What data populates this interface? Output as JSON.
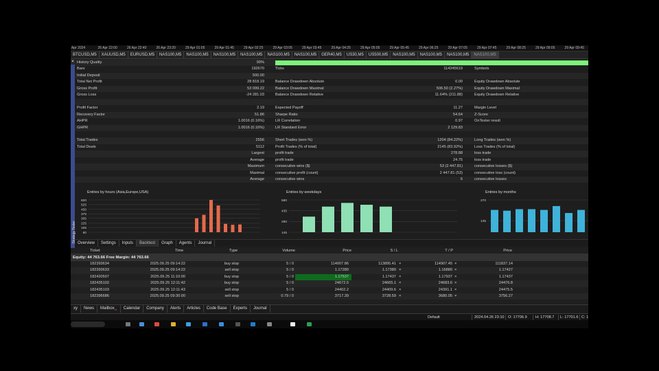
{
  "time_axis": [
    "6 Apr 2024",
    "26 Apr 22:00",
    "26 Apr 22:40",
    "26 Apr 23:20",
    "29 Apr 01:05",
    "29 Apr 01:45",
    "29 Apr 02:25",
    "29 Apr 03:05",
    "29 Apr 03:45",
    "29 Apr 04:25",
    "29 Apr 05:05",
    "29 Apr 05:45",
    "29 Apr 06:25",
    "29 Apr 07:05",
    "29 Apr 07:45",
    "29 Apr 08:25",
    "29 Apr 09:05",
    "29 Apr 09:45"
  ],
  "chart_tabs": [
    "BTCUSD,M5",
    "XAUUSD,M5",
    "EURUSD,M5",
    "NAS100,M5",
    "NAS100,M5",
    "NAS100,M5",
    "NAS100,M5",
    "NAS100,M5",
    "NAS100,M5",
    "GER40,M5",
    "US30,M5",
    "US500,M5",
    "NAS100,M5",
    "NAS100,M5",
    "NAS100,M5",
    "NAS100,M5"
  ],
  "strategy_tester": {
    "close_symbol": "×",
    "vertical_title": "Strategy Tester",
    "rows": [
      {
        "c1": "History Quality",
        "v1": "99%",
        "c2": "",
        "v2": "",
        "c3": "",
        "greenbar": true
      },
      {
        "c1": "Bars",
        "v1": "192670",
        "c2": "Ticks",
        "v2": "114245619",
        "c3": "Symbols"
      },
      {
        "c1": "Initial Deposit",
        "v1": "500.00",
        "c2": "",
        "v2": "",
        "c3": ""
      },
      {
        "c1": "Total Net Profit",
        "v1": "28 818.19",
        "c2": "Balance Drawdown Absolute",
        "v2": "0.00",
        "c3": "Equity Drawdown Absolute"
      },
      {
        "c1": "Gross Profit",
        "v1": "53 099.22",
        "c2": "Balance Drawdown Maximal",
        "v2": "506.50 (2.27%)",
        "c3": "Equity Drawdown Maximal"
      },
      {
        "c1": "Gross Loss",
        "v1": "-24 281.03",
        "c2": "Balance Drawdown Relative",
        "v2": "11.64% (211.88)",
        "c3": "Equity Drawdown Relative"
      },
      {
        "c1": "",
        "v1": "",
        "c2": "",
        "v2": "",
        "c3": ""
      },
      {
        "c1": "Profit Factor",
        "v1": "2.19",
        "c2": "Expected Payoff",
        "v2": "11.27",
        "c3": "Margin Level"
      },
      {
        "c1": "Recovery Factor",
        "v1": "51.86",
        "c2": "Sharpe Ratio",
        "v2": "54.64",
        "c3": "Z-Score"
      },
      {
        "c1": "AHPR",
        "v1": "1.0016 (0.16%)",
        "c2": "LR Correlation",
        "v2": "0.97",
        "c3": "OnTester result"
      },
      {
        "c1": "GHPR",
        "v1": "1.0016 (0.16%)",
        "c2": "LR Standard Error",
        "v2": "2 129.83",
        "c3": ""
      },
      {
        "c1": "",
        "v1": "",
        "c2": "",
        "v2": "",
        "c3": ""
      },
      {
        "c1": "Total Trades",
        "v1": "2556",
        "c2": "Short Trades (won %)",
        "v2": "1204 (84.22%)",
        "c3": "Long Trades (won %)"
      },
      {
        "c1": "Total Deals",
        "v1": "5112",
        "c2": "Profit Trades (% of total)",
        "v2": "2145 (83.92%)",
        "c3": "Loss Trades (% of total)"
      },
      {
        "c1": "",
        "v1": "Largest",
        "c2": "profit trade",
        "v2": "278.88",
        "c3": "loss trade"
      },
      {
        "c1": "",
        "v1": "Average",
        "c2": "profit trade",
        "v2": "24.75",
        "c3": "loss trade"
      },
      {
        "c1": "",
        "v1": "Maximum",
        "c2": "consecutive wins ($)",
        "v2": "53 (2 447.81)",
        "c3": "consecutive losses ($)"
      },
      {
        "c1": "",
        "v1": "Maximal",
        "c2": "consecutive profit (count)",
        "v2": "2 447.81 (53)",
        "c3": "consecutive loss (count)"
      },
      {
        "c1": "",
        "v1": "Average",
        "c2": "consecutive wins",
        "v2": "6",
        "c3": "consecutive losses"
      }
    ],
    "tabs": [
      "Overview",
      "Settings",
      "Inputs",
      "Backtest",
      "Graph",
      "Agents",
      "Journal"
    ],
    "active_tab": "Backtest"
  },
  "chart_data": [
    {
      "type": "bar",
      "title": "Entries by hours (Asia,Europe,USA)",
      "y_ticks": [
        600,
        525,
        450,
        375,
        305,
        225,
        155,
        80
      ],
      "ylim": [
        80,
        600
      ],
      "categories": [
        "9",
        "10",
        "11",
        "12",
        "13",
        "14",
        "15"
      ],
      "values": [
        305,
        360,
        600,
        510,
        215,
        200,
        205
      ],
      "color": "#e56a4c"
    },
    {
      "type": "bar",
      "title": "Entries by weekdays",
      "y_ticks": [
        580,
        435,
        290,
        145
      ],
      "ylim": [
        145,
        580
      ],
      "categories": [
        "Mon",
        "Tue",
        "Wed",
        "Thu",
        "Fri"
      ],
      "values": [
        355,
        490,
        540,
        515,
        490
      ],
      "color": "#8fe0b4"
    },
    {
      "type": "bar",
      "title": "Entries by months",
      "y_ticks": [
        270,
        135
      ],
      "ylim": [
        60,
        270
      ],
      "categories": [
        "1",
        "2",
        "3",
        "4",
        "5",
        "6",
        "7",
        "8",
        "9",
        "10"
      ],
      "values": [
        205,
        200,
        210,
        210,
        205,
        230,
        185,
        205
      ],
      "color": "#3fb3d9"
    }
  ],
  "trade": {
    "headers": [
      "Ticket",
      "Time",
      "Type",
      "Volume",
      "Price",
      "S / L",
      "T / P",
      "Price"
    ],
    "equity_text": "Equity: 44 763.66   Free Margin: 44 763.66",
    "rows": [
      {
        "ticket": "182393634",
        "time": "2025.09.25 09:14:22",
        "type": "buy stop",
        "volume": "5 / 0",
        "price": "114007.86",
        "sl": "113895.41",
        "tp": "114907.45",
        "cur": "111837.14"
      },
      {
        "ticket": "182393633",
        "time": "2025.09.25 09:14:22",
        "type": "sell stop",
        "volume": "5 / 0",
        "price": "1.17280",
        "sl": "1.17380",
        "tp": "1.16880",
        "cur": "1.17427"
      },
      {
        "ticket": "182420597",
        "time": "2025.09.25 11:10:00",
        "type": "buy stop",
        "volume": "5 / 0",
        "price": "1.17537",
        "sl": "1.17437",
        "tp": "1.17937",
        "cur": "1.17437",
        "highlight": true
      },
      {
        "ticket": "182435102",
        "time": "2025.09.25 12:11:42",
        "type": "buy stop",
        "volume": "5 / 0",
        "price": "24672.5",
        "sl": "24665.1",
        "tp": "24683.6",
        "cur": "24476.8"
      },
      {
        "ticket": "182435103",
        "time": "2025.09.25 12:11:43",
        "type": "sell stop",
        "volume": "5 / 0",
        "price": "24402.2",
        "sl": "24409.6",
        "tp": "24391.1",
        "cur": "24475.5"
      },
      {
        "ticket": "182396686",
        "time": "2025.09.25 09:30:00",
        "type": "sell stop",
        "volume": "0.79 / 0",
        "price": "3717.39",
        "sl": "3728.59",
        "tp": "3680.05",
        "cur": "3756.27"
      }
    ]
  },
  "toolbox_tabs": [
    "xy",
    "News",
    "Mailbox",
    "Calendar",
    "Company",
    "Alerts",
    "Articles",
    "Code Base",
    "Experts",
    "Journal"
  ],
  "mailbox_badge": "11",
  "status": {
    "profile": "Default",
    "datetime": "2024.04.26 23:10",
    "open": "O: 17706.9",
    "high": "H: 17708.7",
    "low": "L: 17701.6",
    "close": "C: 1"
  },
  "colors": {
    "green_bar": "#7cf37c",
    "highlight": "#0f6b1e",
    "side_strip": "#3c4c8c"
  }
}
